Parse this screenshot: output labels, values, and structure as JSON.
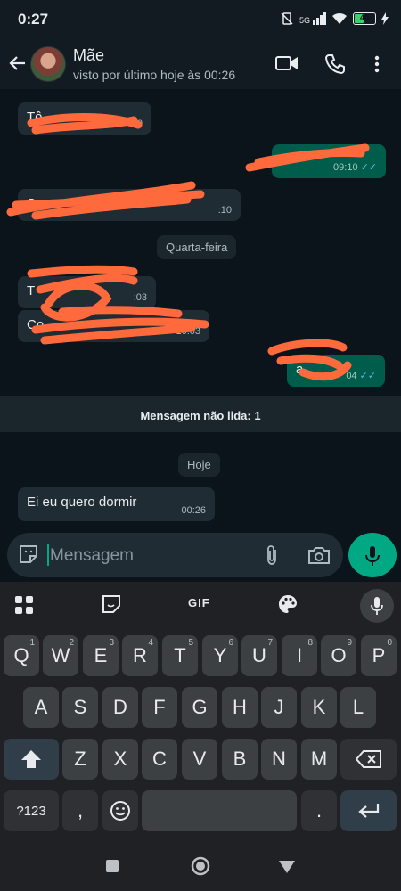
{
  "status_bar": {
    "time": "0:27",
    "network": "5G",
    "battery": "40"
  },
  "header": {
    "contact_name": "Mãe",
    "last_seen": "visto por último hoje às 00:26",
    "icons": [
      "back-arrow-icon",
      "video-call-icon",
      "phone-icon",
      "more-vert-icon"
    ]
  },
  "chat": {
    "messages": [
      {
        "dir": "in",
        "text": "Tô",
        "time": ":10"
      },
      {
        "dir": "out",
        "text": "",
        "time": "09:10"
      },
      {
        "dir": "in",
        "text": "S",
        "time": ":10"
      },
      {
        "dir": "in",
        "text": "T",
        "time": ":03"
      },
      {
        "dir": "in",
        "text": "Co",
        "time": "10:03"
      },
      {
        "dir": "out",
        "text": "a",
        "time": "04"
      },
      {
        "dir": "in",
        "text": "Ei eu quero dormir",
        "time": "00:26"
      }
    ],
    "date_chips": {
      "wednesday": "Quarta-feira",
      "today": "Hoje"
    },
    "unread_label": "Mensagem não lida: 1"
  },
  "input": {
    "placeholder": "Mensagem",
    "icons": [
      "sticker-icon",
      "attach-icon",
      "camera-icon",
      "mic-icon"
    ]
  },
  "keyboard": {
    "toolbar": {
      "gif": "GIF"
    },
    "row1": [
      [
        "Q",
        "1"
      ],
      [
        "W",
        "2"
      ],
      [
        "E",
        "3"
      ],
      [
        "R",
        "4"
      ],
      [
        "T",
        "5"
      ],
      [
        "Y",
        "6"
      ],
      [
        "U",
        "7"
      ],
      [
        "I",
        "8"
      ],
      [
        "O",
        "9"
      ],
      [
        "P",
        "0"
      ]
    ],
    "row2": [
      "A",
      "S",
      "D",
      "F",
      "G",
      "H",
      "J",
      "K",
      "L"
    ],
    "row3": [
      "Z",
      "X",
      "C",
      "V",
      "B",
      "N",
      "M"
    ],
    "bottom": {
      "symbols": "?123",
      "comma": ",",
      "period": "."
    }
  },
  "colors": {
    "accent": "#00a884",
    "outgoing": "#005c4b",
    "incoming": "#202c33",
    "redaction": "#ff6a3d"
  }
}
